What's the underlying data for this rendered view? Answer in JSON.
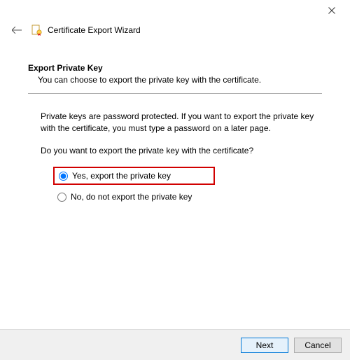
{
  "window": {
    "title": "Certificate Export Wizard"
  },
  "section": {
    "title": "Export Private Key",
    "subtitle": "You can choose to export the private key with the certificate."
  },
  "body": {
    "intro": "Private keys are password protected. If you want to export the private key with the certificate, you must type a password on a later page.",
    "question": "Do you want to export the private key with the certificate?"
  },
  "options": {
    "yes": "Yes, export the private key",
    "no": "No, do not export the private key"
  },
  "buttons": {
    "next": "Next",
    "cancel": "Cancel"
  }
}
